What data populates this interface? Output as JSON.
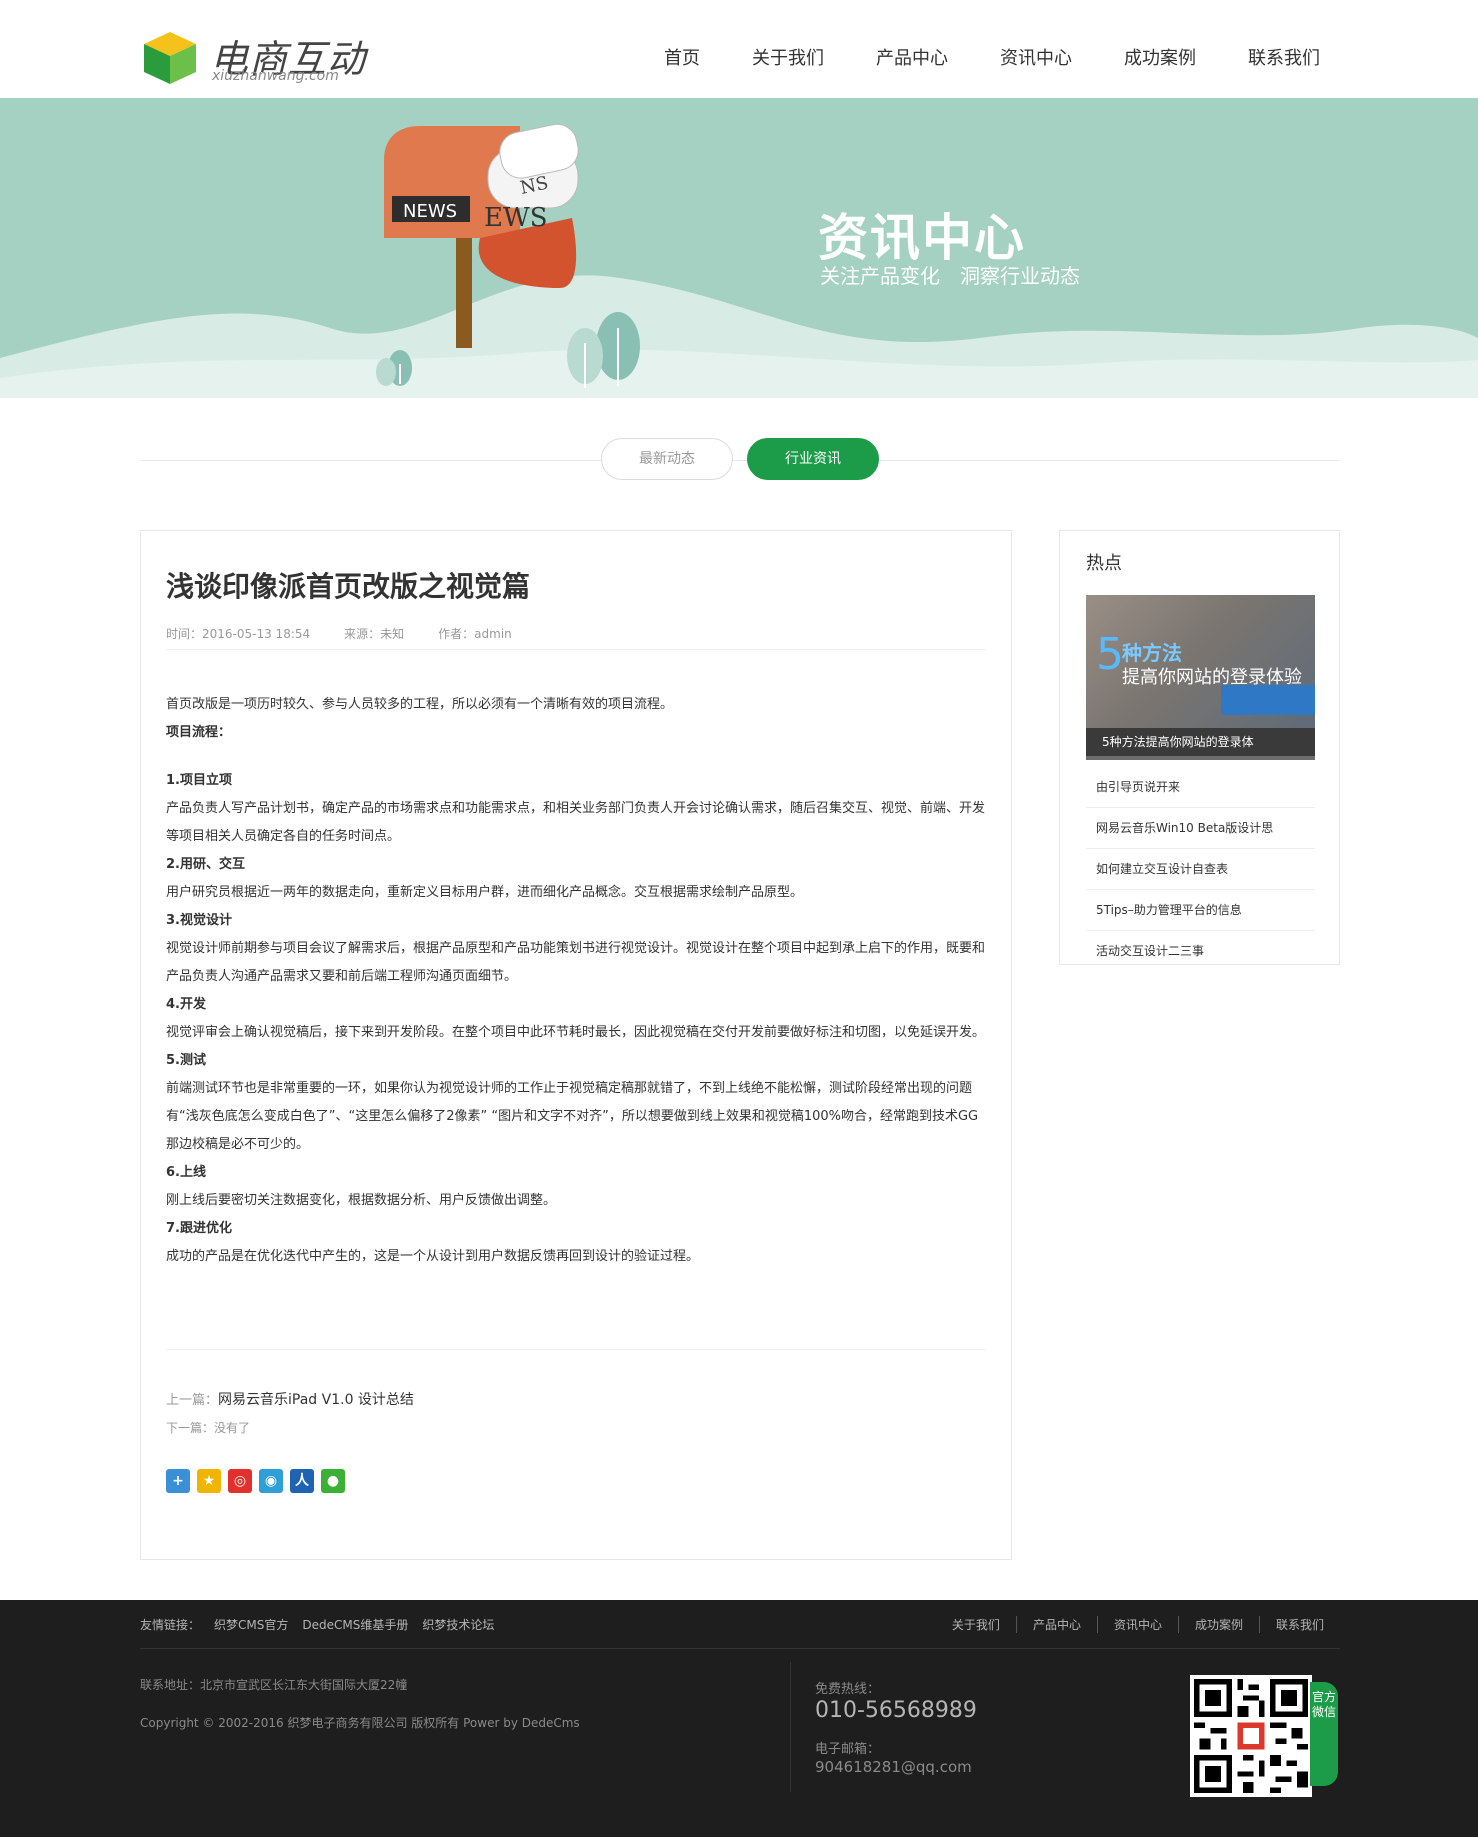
{
  "header": {
    "logo_title": "电商互动",
    "logo_sub": "xiuzhanwang.com",
    "nav": [
      "首页",
      "关于我们",
      "产品中心",
      "资讯中心",
      "成功案例",
      "联系我们"
    ]
  },
  "banner": {
    "title": "资讯中心",
    "subtitle": "关注产品变化　洞察行业动态",
    "sign_left": "NEWS",
    "sign_right": "EWS",
    "sign_top": "NS"
  },
  "tabs": [
    "最新动态",
    "行业资讯"
  ],
  "article": {
    "title": "浅谈印像派首页改版之视觉篇",
    "meta": {
      "time": "时间：2016-05-13 18:54",
      "source": "来源：未知",
      "author": "作者：admin"
    },
    "intro": "首页改版是一项历时较久、参与人员较多的工程，所以必须有一个清晰有效的项目流程。",
    "flow_label": "项目流程：",
    "steps": [
      {
        "title": "1.项目立项",
        "text": "产品负责人写产品计划书，确定产品的市场需求点和功能需求点，和相关业务部门负责人开会讨论确认需求，随后召集交互、视觉、前端、开发等项目相关人员确定各自的任务时间点。"
      },
      {
        "title": "2.用研、交互",
        "text": "用户研究员根据近一两年的数据走向，重新定义目标用户群，进而细化产品概念。交互根据需求绘制产品原型。"
      },
      {
        "title": "3.视觉设计",
        "text": "视觉设计师前期参与项目会议了解需求后，根据产品原型和产品功能策划书进行视觉设计。视觉设计在整个项目中起到承上启下的作用，既要和产品负责人沟通产品需求又要和前后端工程师沟通页面细节。"
      },
      {
        "title": "4.开发",
        "text": "视觉评审会上确认视觉稿后，接下来到开发阶段。在整个项目中此环节耗时最长，因此视觉稿在交付开发前要做好标注和切图，以免延误开发。"
      },
      {
        "title": "5.测试",
        "text": "前端测试环节也是非常重要的一环，如果你认为视觉设计师的工作止于视觉稿定稿那就错了，不到上线绝不能松懈，测试阶段经常出现的问题有“浅灰色底怎么变成白色了”、“这里怎么偏移了2像素” “图片和文字不对齐”，所以想要做到线上效果和视觉稿100%吻合，经常跑到技术GG那边校稿是必不可少的。"
      },
      {
        "title": "6.上线",
        "text": "刚上线后要密切关注数据变化，根据数据分析、用户反馈做出调整。"
      },
      {
        "title": "7.跟进优化",
        "text": "成功的产品是在优化迭代中产生的，这是一个从设计到用户数据反馈再回到设计的验证过程。"
      }
    ],
    "prev_label": "上一篇：",
    "prev_title": "网易云音乐iPad V1.0 设计总结",
    "next_label": "下一篇：没有了"
  },
  "sidebar": {
    "title": "热点",
    "image": {
      "big_digit": "5",
      "line1": "种方法",
      "line2": "提高你网站的登录体验",
      "caption": "5种方法提高你网站的登录体"
    },
    "items": [
      "由引导页说开来",
      "网易云音乐Win10 Beta版设计思",
      "如何建立交互设计自查表",
      "5Tips–助力管理平台的信息",
      "活动交互设计二三事"
    ]
  },
  "footer": {
    "links_label": "友情链接：",
    "links": [
      "织梦CMS官方",
      "DedeCMS维基手册",
      "织梦技术论坛"
    ],
    "nav": [
      "关于我们",
      "产品中心",
      "资讯中心",
      "成功案例",
      "联系我们"
    ],
    "address": "联系地址：北京市宣武区长江东大街国际大厦22幢",
    "copyright": "Copyright © 2002-2016 织梦电子商务有限公司 版权所有 Power by DedeCms",
    "hotline_label": "免费热线：",
    "hotline": "010-56568989",
    "email_label": "电子邮箱：",
    "email": "904618281@qq.com",
    "qr_tab": "官方微信"
  },
  "colors": {
    "brand_green": "#1c9c48",
    "banner_bg": "#a4d1c2",
    "footer_bg": "#1e1e1e"
  }
}
